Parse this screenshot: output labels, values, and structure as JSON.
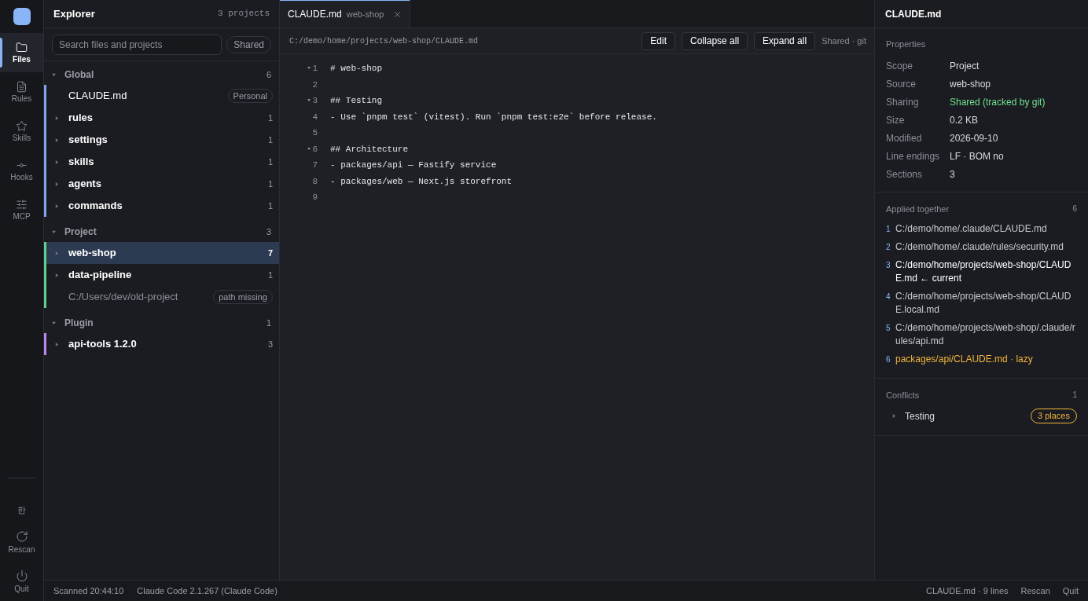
{
  "rail": {
    "nav": [
      {
        "label": "Files",
        "selected": true
      },
      {
        "label": "Rules",
        "selected": false
      },
      {
        "label": "Skills",
        "selected": false
      },
      {
        "label": "Hooks",
        "selected": false
      },
      {
        "label": "MCP",
        "selected": false
      }
    ],
    "language": "한",
    "actions": [
      {
        "label": "Rescan"
      },
      {
        "label": "Quit"
      }
    ]
  },
  "explorer": {
    "title": "Explorer",
    "count": "3 projects",
    "search": {
      "placeholder": "Search files and projects"
    },
    "filter": "Shared",
    "groups": [
      {
        "label": "Global",
        "count": "6",
        "color": "#7fa4f0",
        "expanded": true,
        "items": [
          {
            "kind": "file",
            "label": "CLAUDE.md",
            "badge": "Personal",
            "selected": false
          },
          {
            "kind": "folder",
            "label": "rules",
            "count": "1",
            "selected": false
          },
          {
            "kind": "folder",
            "label": "settings",
            "count": "1",
            "selected": false
          },
          {
            "kind": "folder",
            "label": "skills",
            "count": "1",
            "selected": false
          },
          {
            "kind": "folder",
            "label": "agents",
            "count": "1",
            "selected": false
          },
          {
            "kind": "folder",
            "label": "commands",
            "count": "1",
            "selected": false
          }
        ]
      },
      {
        "label": "Project",
        "count": "3",
        "color": "#5fd08a",
        "expanded": true,
        "items": [
          {
            "kind": "folder",
            "label": "web-shop",
            "count": "7",
            "selected": true
          },
          {
            "kind": "folder",
            "label": "data-pipeline",
            "count": "1",
            "selected": false
          },
          {
            "kind": "missing",
            "label": "C:/Users/dev/old-project",
            "badge": "path missing",
            "selected": false
          }
        ]
      },
      {
        "label": "Plugin",
        "count": "1",
        "color": "#b48cf0",
        "expanded": true,
        "items": [
          {
            "kind": "folder",
            "label": "api-tools 1.2.0",
            "count": "3",
            "selected": false
          }
        ]
      }
    ]
  },
  "editor": {
    "tabs": [
      {
        "title": "CLAUDE.md",
        "subtitle": "web-shop",
        "selected": true
      }
    ],
    "path": "C:/demo/home/projects/web-shop/CLAUDE.md",
    "buttons": [
      "Edit",
      "Collapse all",
      "Expand all"
    ],
    "status": "Shared · git",
    "lines": [
      {
        "number": "1",
        "text": "# web-shop",
        "foldable": true
      },
      {
        "number": "2",
        "foldable": false
      },
      {
        "number": "3",
        "text": "## Testing",
        "foldable": true
      },
      {
        "number": "4",
        "text": "- Use `pnpm test` (vitest). Run `pnpm test:e2e` before release.",
        "foldable": false
      },
      {
        "number": "5",
        "foldable": false
      },
      {
        "number": "6",
        "text": "## Architecture",
        "foldable": true
      },
      {
        "number": "7",
        "text": "- packages/api — Fastify service",
        "foldable": false
      },
      {
        "number": "8",
        "text": "- packages/web — Next.js storefront",
        "foldable": false
      },
      {
        "number": "9",
        "foldable": false
      }
    ]
  },
  "inspector": {
    "title": "CLAUDE.md",
    "properties": {
      "title": "Properties",
      "rows": [
        {
          "label": "Scope",
          "value": "Project",
          "highlighted": false
        },
        {
          "label": "Source",
          "value": "web-shop",
          "highlighted": false
        },
        {
          "label": "Sharing",
          "value": "Shared (tracked by git)",
          "highlighted": true
        },
        {
          "label": "Size",
          "value": "0.2 KB",
          "highlighted": false
        },
        {
          "label": "Modified",
          "value": "2026-09-10",
          "highlighted": false
        },
        {
          "label": "Line endings",
          "value": "LF · BOM no",
          "highlighted": false
        },
        {
          "label": "Sections",
          "value": "3",
          "highlighted": false
        }
      ]
    },
    "applied": {
      "title": "Applied together",
      "count": "6",
      "items": [
        {
          "index": "1",
          "path": "C:/demo/home/.claude/CLAUDE.md",
          "kind": "normal"
        },
        {
          "index": "2",
          "path": "C:/demo/home/.claude/rules/security.md",
          "kind": "normal"
        },
        {
          "index": "3",
          "path": "C:/demo/home/projects/web-shop/CLAUDE.md ← current",
          "kind": "current"
        },
        {
          "index": "4",
          "path": "C:/demo/home/projects/web-shop/CLAUDE.local.md",
          "kind": "normal"
        },
        {
          "index": "5",
          "path": "C:/demo/home/projects/web-shop/.claude/rules/api.md",
          "kind": "normal"
        },
        {
          "index": "6",
          "path": "packages/api/CLAUDE.md · lazy",
          "kind": "lazy"
        }
      ]
    },
    "conflicts": {
      "title": "Conflicts",
      "count": "1",
      "items": [
        {
          "label": "Testing",
          "badge": "3 places",
          "expanded": false
        }
      ]
    }
  },
  "status_bar": {
    "left": [
      "Scanned 20:44:10",
      "Claude Code 2.1.267 (Claude Code)"
    ],
    "right": [
      "CLAUDE.md · 9 lines",
      "Rescan",
      "Quit"
    ]
  }
}
